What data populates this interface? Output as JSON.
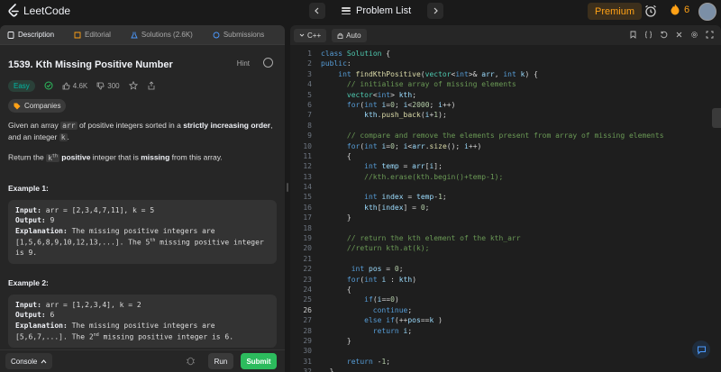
{
  "app": {
    "logo_text": "LeetCode",
    "problem_list_label": "Problem List",
    "premium_label": "Premium",
    "streak_count": "6",
    "accent": "#ffa116"
  },
  "tabs": [
    {
      "label": "Description",
      "active": true
    },
    {
      "label": "Editorial",
      "active": false
    },
    {
      "label": "Solutions (2.6K)",
      "active": false
    },
    {
      "label": "Submissions",
      "active": false
    }
  ],
  "problem": {
    "title": "1539. Kth Missing Positive Number",
    "hint_label": "Hint",
    "difficulty": "Easy",
    "likes": "4.6K",
    "dislikes": "300",
    "companies_label": "Companies",
    "desc1_a": "Given an array ",
    "desc1_code1": "arr",
    "desc1_b": " of positive integers sorted in a ",
    "desc1_bold": "strictly increasing order",
    "desc1_c": ", and an integer ",
    "desc1_code2": "k",
    "desc1_d": ".",
    "desc2_a": "Return the ",
    "desc2_k": "k",
    "desc2_sup": "th",
    "desc2_bold1": "positive",
    "desc2_b": " integer that is ",
    "desc2_bold2": "missing",
    "desc2_c": " from this array."
  },
  "examples": [
    {
      "title": "Example 1:",
      "input_label": "Input:",
      "input": " arr = [2,3,4,7,11], k = 5",
      "output_label": "Output:",
      "output": " 9",
      "explanation_label": "Explanation:",
      "explanation_a": " The missing positive integers are [1,5,6,8,9,10,12,13,...]. The 5",
      "explanation_sup": "th",
      "explanation_b": " missing positive integer is 9."
    },
    {
      "title": "Example 2:",
      "input_label": "Input:",
      "input": " arr = [1,2,3,4], k = 2",
      "output_label": "Output:",
      "output": " 6",
      "explanation_label": "Explanation:",
      "explanation_a": " The missing positive integers are [5,6,7,...]. The 2",
      "explanation_sup": "nd",
      "explanation_b": " missing positive integer is 6."
    }
  ],
  "bottom": {
    "console_label": "Console",
    "run_label": "Run",
    "submit_label": "Submit"
  },
  "editor": {
    "language": "C++",
    "mode": "Auto",
    "current_line": 26
  }
}
